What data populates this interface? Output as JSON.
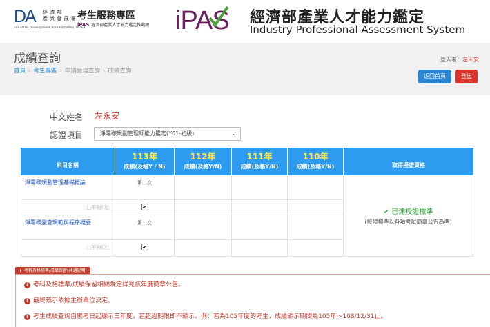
{
  "header": {
    "agency_logo_text": "DA",
    "agency_name_cn": [
      "經 濟 部",
      "產 業 發 展 署"
    ],
    "agency_name_en": "Industrial Development Administration, MOEA",
    "exam_center_title": "考生服務專區",
    "exam_center_sub_brand": "iPAS",
    "exam_center_sub": "經濟部產業人才能力鑑定推動網",
    "brand_logo_text": "iPAS",
    "brand_title_cn": "經濟部產業人才能力鑑定",
    "brand_title_en": "Industry Professional Assessment System",
    "colors": {
      "brand_purple": "#6b1f5c",
      "brand_green": "#4aa53a"
    }
  },
  "title_bar": {
    "page_title": "成績查詢",
    "breadcrumb": [
      "首頁",
      "考生專區",
      "申請管理查詢",
      "成績查詢"
    ],
    "login_label": "登入者：",
    "login_user": "左＊安",
    "home_button": "返回首頁",
    "logout_button": "登出",
    "colors": {
      "home": "#2a86d1",
      "logout": "#d9342b"
    }
  },
  "form": {
    "name_label": "中文姓名",
    "name_value": "左永安",
    "cert_label": "認證項目",
    "cert_selected": "淨零碳規劃管理師能力鑑定(Y01-初級)"
  },
  "score_table": {
    "header": {
      "subject": "科目名稱",
      "years": [
        {
          "year": "113年",
          "sub": "成績(及格Y / N)"
        },
        {
          "year": "112年",
          "sub": "成績(及格Y/N)"
        },
        {
          "year": "111年",
          "sub": "成績(及格Y/N)"
        },
        {
          "year": "110年",
          "sub": "成績(及格Y/N)"
        }
      ],
      "qualification": "取得授證資格"
    },
    "rows": [
      {
        "subject": "淨零碳規劃管理基礎概論",
        "y113": "第二次",
        "not_listed": "□不列印□",
        "checked": true
      },
      {
        "subject": "淨零碳盤查規範與程序概要",
        "y113": "第二次",
        "not_listed": "□不列印□",
        "checked": true
      }
    ],
    "qualification_status": "已達授證標準",
    "qualification_note": "(授證標準以各項考試簡章公告為準)",
    "colors": {
      "header_bg": "#2d9bf0",
      "year": "#ffec48",
      "status": "#2ea43a"
    }
  },
  "notes": {
    "tag": "考科及格標準/成績保留(共通說明)",
    "items": [
      "考科及格標準/成績保留相關規定詳見該年度簡章公告。",
      "最終裁示依據主辦單位決定。",
      "考生成績查詢自應考日起顯示三年度，若超過期限即不顯示。例：若為105年度的考生，成績顯示期間為105年～108/12/31止。"
    ],
    "color": "#c0392b"
  }
}
